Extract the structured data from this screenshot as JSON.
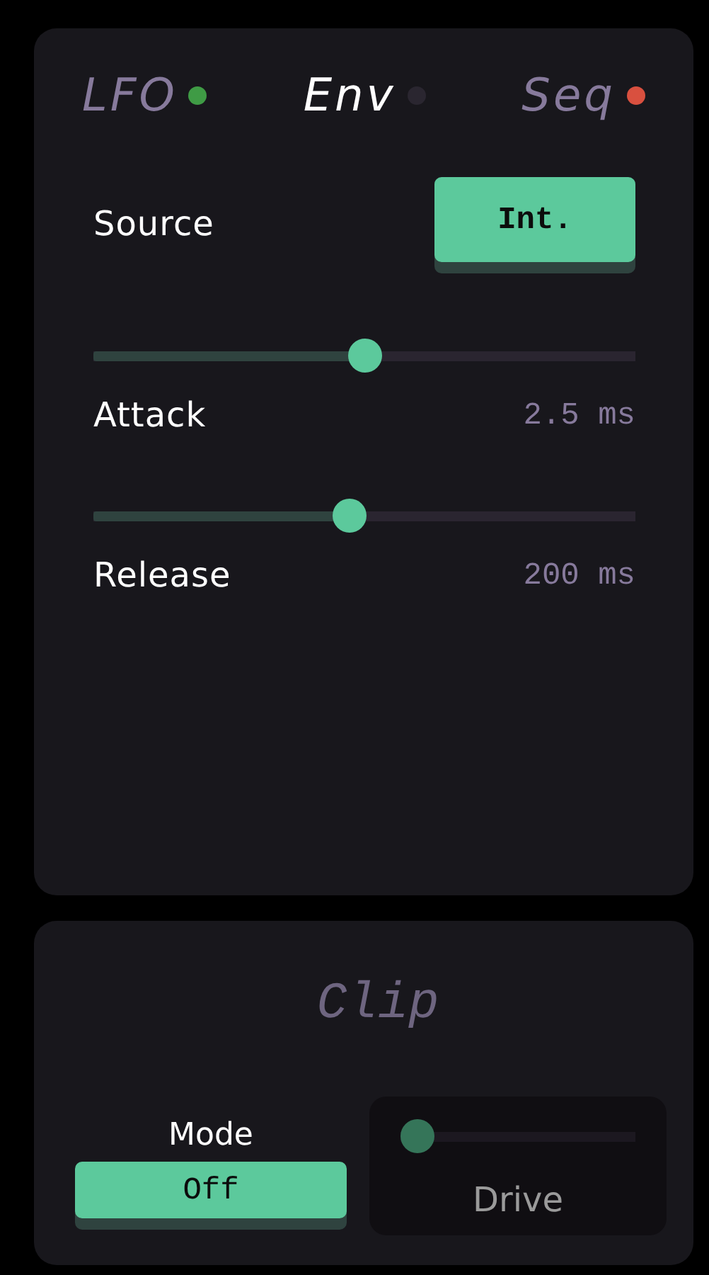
{
  "tabs": [
    {
      "label": "LFO",
      "selected": false,
      "color": "#3f9b45"
    },
    {
      "label": "Env",
      "selected": true,
      "color": "#2a2630"
    },
    {
      "label": "Seq",
      "selected": false,
      "color": "#d9503f"
    }
  ],
  "source": {
    "label": "Source",
    "button": "Int."
  },
  "sliders": [
    {
      "label": "Attack",
      "reading": "2.5 ms",
      "level": 0.5
    },
    {
      "label": "Release",
      "reading": "200 ms",
      "level": 0.47
    }
  ],
  "clip": {
    "title": "Clip",
    "mode": {
      "label": "Mode",
      "button": "Off"
    },
    "drive": {
      "label": "Drive",
      "level": 0,
      "disabled": true
    }
  }
}
